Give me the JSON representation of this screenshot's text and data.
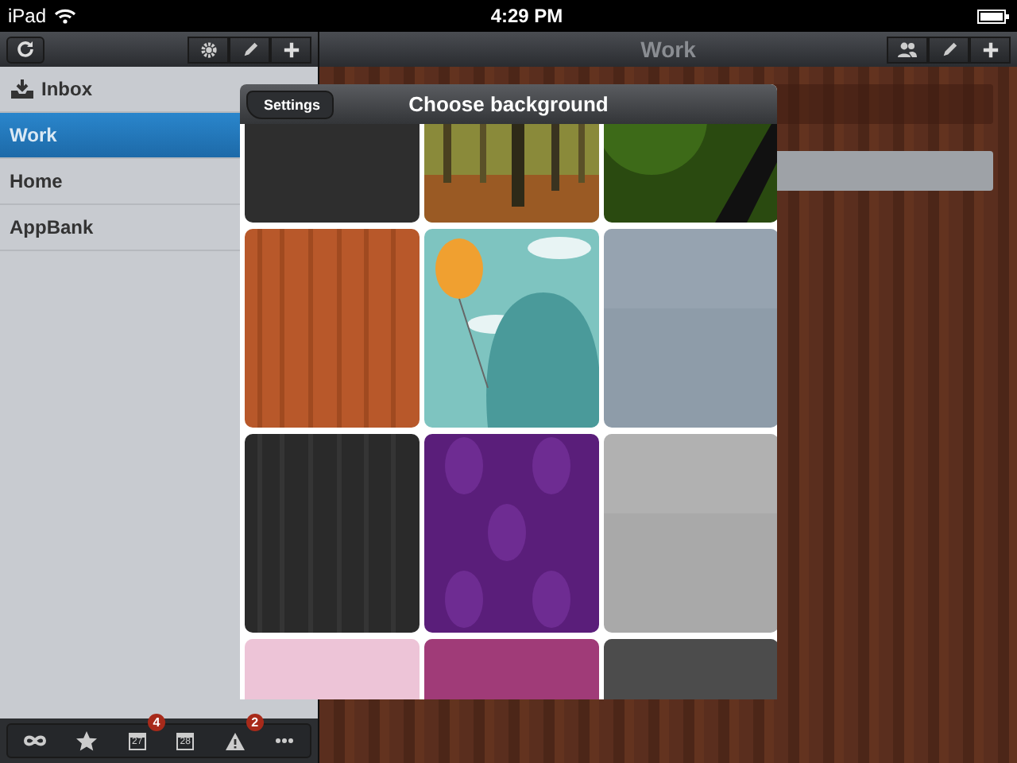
{
  "status_bar": {
    "device": "iPad",
    "time": "4:29 PM"
  },
  "sidebar": {
    "items": [
      {
        "label": "Inbox",
        "kind": "inbox",
        "selected": false
      },
      {
        "label": "Work",
        "kind": "list",
        "selected": true
      },
      {
        "label": "Home",
        "kind": "list",
        "selected": false
      },
      {
        "label": "AppBank",
        "kind": "list",
        "selected": false
      }
    ]
  },
  "bottom_toolbar": [
    {
      "kind": "infinity"
    },
    {
      "kind": "star"
    },
    {
      "kind": "calendar",
      "day": "27",
      "badge": "4"
    },
    {
      "kind": "calendar",
      "day": "28"
    },
    {
      "kind": "warning",
      "badge": "2"
    },
    {
      "kind": "more"
    }
  ],
  "main": {
    "title": "Work"
  },
  "popover": {
    "back": "Settings",
    "title": "Choose background",
    "tiles": [
      {
        "kind": "chalkboard"
      },
      {
        "kind": "forest"
      },
      {
        "kind": "leaf"
      },
      {
        "kind": "wood"
      },
      {
        "kind": "cartoon"
      },
      {
        "kind": "slate"
      },
      {
        "kind": "darkwood"
      },
      {
        "kind": "damask"
      },
      {
        "kind": "silver"
      },
      {
        "kind": "pink"
      },
      {
        "kind": "magenta"
      },
      {
        "kind": "graphite"
      }
    ]
  }
}
